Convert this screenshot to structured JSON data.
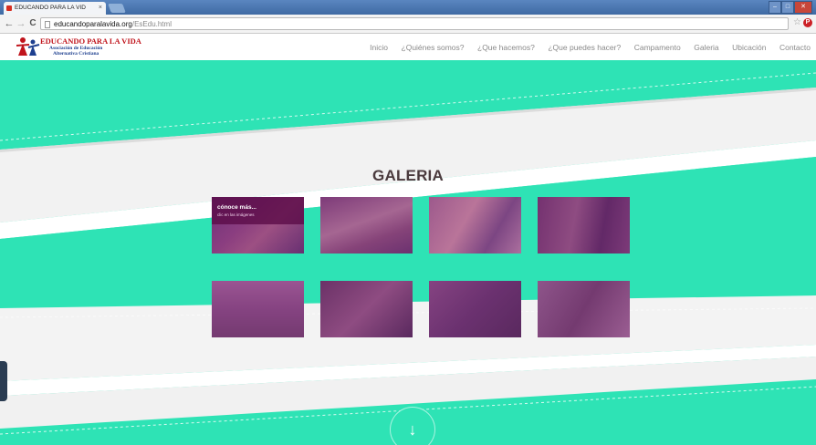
{
  "browser": {
    "tab_title": "EDUCANDO PARA LA VID",
    "tab_close": "×",
    "url_host": "educandoparalavida.org",
    "url_path": "/EsEdu.html",
    "back": "←",
    "forward": "→",
    "reload": "C",
    "bookmark": "☆",
    "pinterest": "P"
  },
  "logo": {
    "title": "EDUCANDO PARA LA VIDA",
    "subtitle1": "Asociación de Educación",
    "subtitle2": "Alternativa Cristiana"
  },
  "menu": [
    {
      "label": "Inicio"
    },
    {
      "label": "¿Quiénes somos?"
    },
    {
      "label": "¿Que hacemos?"
    },
    {
      "label": "¿Que puedes hacer?"
    },
    {
      "label": "Campamento"
    },
    {
      "label": "Galeria"
    },
    {
      "label": "Ubicación"
    },
    {
      "label": "Contacto"
    }
  ],
  "gallery": {
    "title": "GALERIA",
    "caption_title": "cónoce más...",
    "caption_sub": "clic en las imágenes",
    "items": [
      {
        "name": "photo-1"
      },
      {
        "name": "photo-2"
      },
      {
        "name": "photo-3"
      },
      {
        "name": "photo-4"
      },
      {
        "name": "photo-5"
      },
      {
        "name": "photo-6"
      },
      {
        "name": "photo-7"
      },
      {
        "name": "photo-8"
      }
    ]
  },
  "scroll_down": "↓",
  "colors": {
    "accent": "#2ee3b5",
    "overlay": "#802878",
    "title": "#4a3a3d"
  }
}
